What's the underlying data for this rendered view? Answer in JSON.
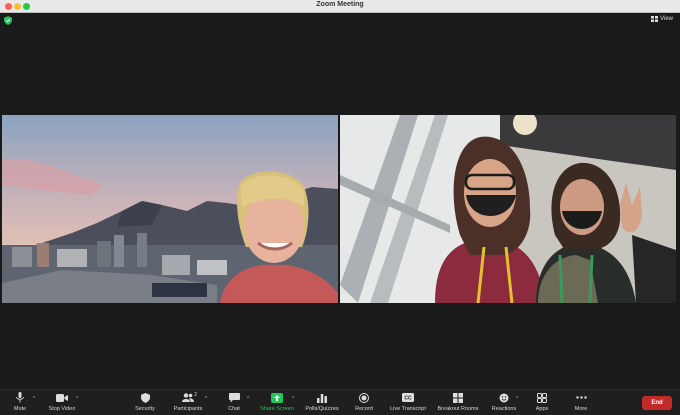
{
  "window": {
    "title": "Zoom Meeting"
  },
  "header": {
    "view_label": "View"
  },
  "toolbar": {
    "mute": "Mute",
    "stop_video": "Stop Video",
    "security": "Security",
    "participants": "Participants",
    "participants_count": "2",
    "chat": "Chat",
    "share_screen": "Share Screen",
    "polls": "Polls/Quizzes",
    "record": "Record",
    "live_transcript": "Live Transcript",
    "breakout_rooms": "Breakout Rooms",
    "reactions": "Reactions",
    "apps": "Apps",
    "more": "More",
    "end": "End"
  },
  "icons": {
    "security_shield": "shield-icon",
    "view": "grid-icon",
    "mute": "microphone-icon",
    "video": "video-camera-icon",
    "participants": "people-icon",
    "chat": "chat-bubble-icon",
    "share": "share-arrow-icon",
    "polls": "bar-chart-icon",
    "record": "record-icon",
    "transcript": "cc-icon",
    "breakout": "grid-icon",
    "reactions": "smile-icon",
    "apps": "apps-icon",
    "more": "ellipsis-icon"
  },
  "colors": {
    "accent_green": "#22c55e",
    "end_red": "#c22a2a"
  }
}
